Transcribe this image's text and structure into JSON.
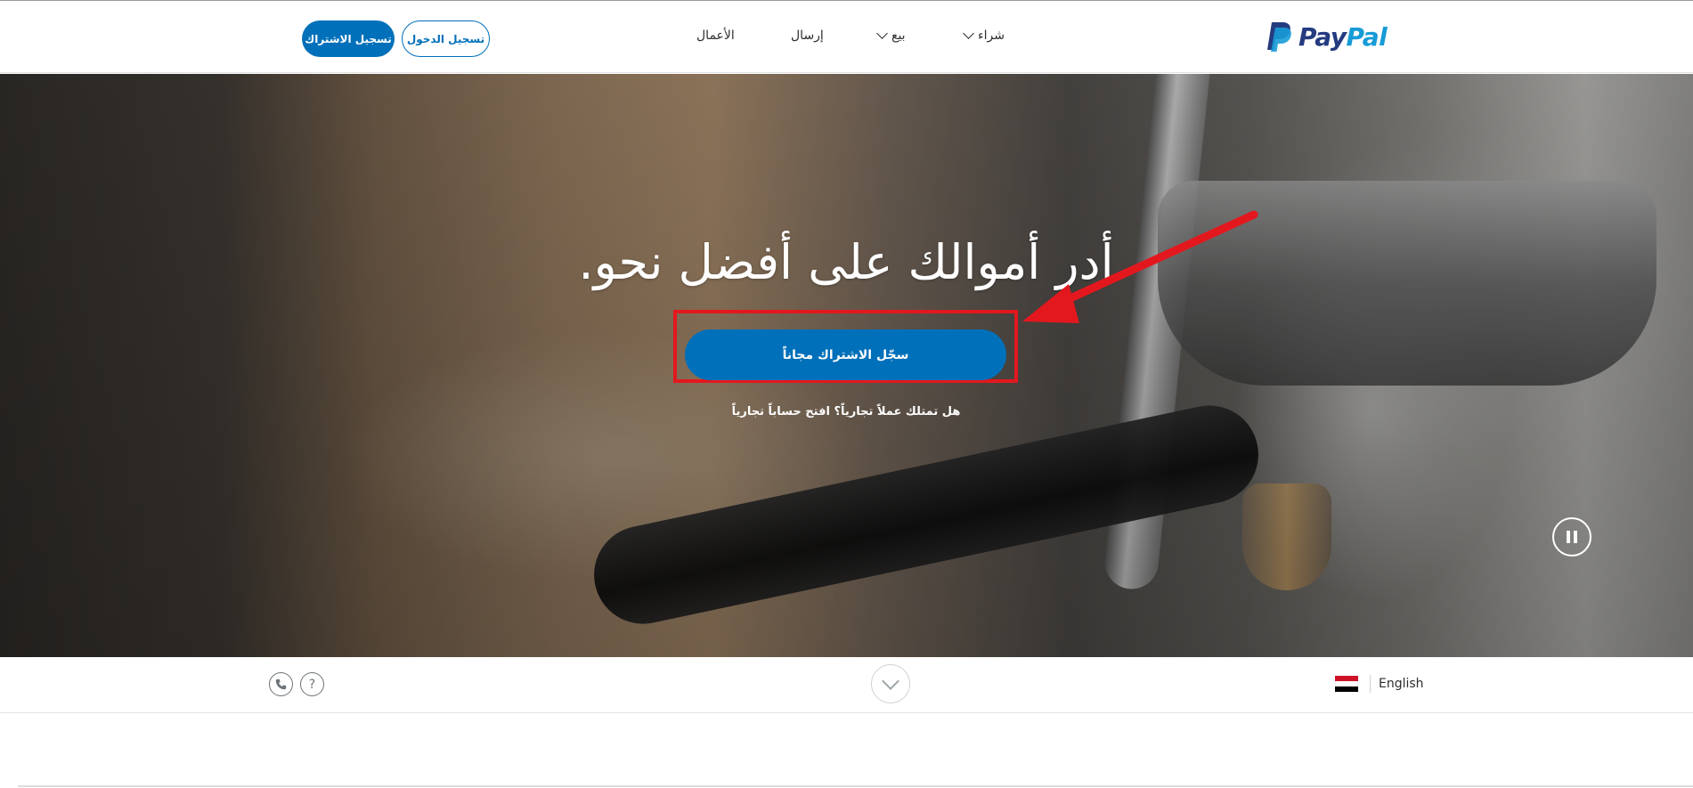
{
  "header": {
    "signup_label": "تسجيل الاشتراك",
    "login_label": "تسجيل الدخول",
    "nav": {
      "business": "الأعمال",
      "send": "إرسال",
      "sell": "بيع",
      "buy": "شراء"
    },
    "logo": {
      "pay": "Pay",
      "pal": "Pal"
    }
  },
  "hero": {
    "title": "أدر أموالك على أفضل نحو.",
    "cta_label": "سجّل الاشتراك مجاناً",
    "business_link": "هل تمتلك عملاً تجارياً؟ افتح حساباً تجارياً",
    "annotation_color": "#e3181e",
    "accent_color": "#0070ba"
  },
  "footer": {
    "phone_icon": "phone-icon",
    "help_icon": "?",
    "language": "English",
    "flag_colors": [
      "#ce1126",
      "#ffffff",
      "#000000"
    ]
  }
}
